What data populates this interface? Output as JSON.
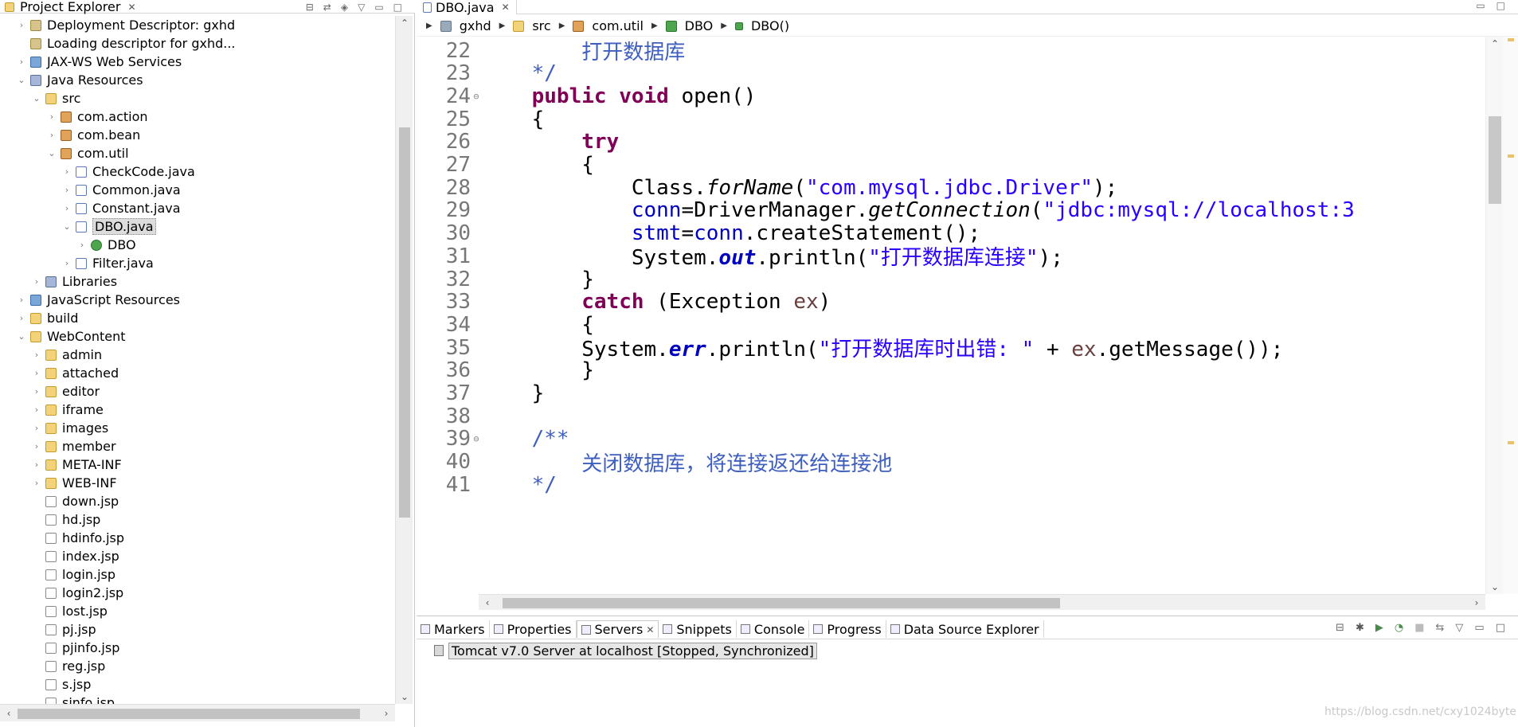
{
  "project_explorer": {
    "title": "Project Explorer",
    "tree": [
      {
        "label": "Deployment Descriptor: gxhd",
        "indent": 1,
        "twisty": ">",
        "icon": "descriptor-icon"
      },
      {
        "label": "Loading descriptor for gxhd...",
        "indent": 1,
        "twisty": "",
        "icon": "descriptor-icon"
      },
      {
        "label": "JAX-WS Web Services",
        "indent": 1,
        "twisty": ">",
        "icon": "web-services-icon"
      },
      {
        "label": "Java Resources",
        "indent": 1,
        "twisty": "v",
        "icon": "java-resources-icon"
      },
      {
        "label": "src",
        "indent": 2,
        "twisty": "v",
        "icon": "source-folder-icon"
      },
      {
        "label": "com.action",
        "indent": 3,
        "twisty": ">",
        "icon": "package-icon"
      },
      {
        "label": "com.bean",
        "indent": 3,
        "twisty": ">",
        "icon": "package-icon"
      },
      {
        "label": "com.util",
        "indent": 3,
        "twisty": "v",
        "icon": "package-icon"
      },
      {
        "label": "CheckCode.java",
        "indent": 4,
        "twisty": ">",
        "icon": "java-file-icon"
      },
      {
        "label": "Common.java",
        "indent": 4,
        "twisty": ">",
        "icon": "java-file-icon"
      },
      {
        "label": "Constant.java",
        "indent": 4,
        "twisty": ">",
        "icon": "java-file-icon"
      },
      {
        "label": "DBO.java",
        "indent": 4,
        "twisty": "v",
        "icon": "java-file-icon",
        "selected": true
      },
      {
        "label": "DBO",
        "indent": 5,
        "twisty": ">",
        "icon": "class-icon"
      },
      {
        "label": "Filter.java",
        "indent": 4,
        "twisty": ">",
        "icon": "java-file-icon"
      },
      {
        "label": "Libraries",
        "indent": 2,
        "twisty": ">",
        "icon": "libraries-icon"
      },
      {
        "label": "JavaScript Resources",
        "indent": 1,
        "twisty": ">",
        "icon": "js-resources-icon"
      },
      {
        "label": "build",
        "indent": 1,
        "twisty": ">",
        "icon": "folder-icon"
      },
      {
        "label": "WebContent",
        "indent": 1,
        "twisty": "v",
        "icon": "folder-icon"
      },
      {
        "label": "admin",
        "indent": 2,
        "twisty": ">",
        "icon": "folder-icon"
      },
      {
        "label": "attached",
        "indent": 2,
        "twisty": ">",
        "icon": "folder-icon"
      },
      {
        "label": "editor",
        "indent": 2,
        "twisty": ">",
        "icon": "folder-icon"
      },
      {
        "label": "iframe",
        "indent": 2,
        "twisty": ">",
        "icon": "folder-icon"
      },
      {
        "label": "images",
        "indent": 2,
        "twisty": ">",
        "icon": "folder-icon"
      },
      {
        "label": "member",
        "indent": 2,
        "twisty": ">",
        "icon": "folder-icon"
      },
      {
        "label": "META-INF",
        "indent": 2,
        "twisty": ">",
        "icon": "folder-icon"
      },
      {
        "label": "WEB-INF",
        "indent": 2,
        "twisty": ">",
        "icon": "folder-icon"
      },
      {
        "label": "down.jsp",
        "indent": 2,
        "twisty": "",
        "icon": "jsp-file-icon"
      },
      {
        "label": "hd.jsp",
        "indent": 2,
        "twisty": "",
        "icon": "jsp-file-icon"
      },
      {
        "label": "hdinfo.jsp",
        "indent": 2,
        "twisty": "",
        "icon": "jsp-file-icon"
      },
      {
        "label": "index.jsp",
        "indent": 2,
        "twisty": "",
        "icon": "jsp-file-icon"
      },
      {
        "label": "login.jsp",
        "indent": 2,
        "twisty": "",
        "icon": "jsp-file-icon"
      },
      {
        "label": "login2.jsp",
        "indent": 2,
        "twisty": "",
        "icon": "jsp-file-icon"
      },
      {
        "label": "lost.jsp",
        "indent": 2,
        "twisty": "",
        "icon": "jsp-file-icon"
      },
      {
        "label": "pj.jsp",
        "indent": 2,
        "twisty": "",
        "icon": "jsp-file-icon"
      },
      {
        "label": "pjinfo.jsp",
        "indent": 2,
        "twisty": "",
        "icon": "jsp-file-icon"
      },
      {
        "label": "reg.jsp",
        "indent": 2,
        "twisty": "",
        "icon": "jsp-file-icon"
      },
      {
        "label": "s.jsp",
        "indent": 2,
        "twisty": "",
        "icon": "jsp-file-icon"
      },
      {
        "label": "sinfo.jsp",
        "indent": 2,
        "twisty": "",
        "icon": "jsp-file-icon"
      }
    ]
  },
  "editor": {
    "tab_label": "DBO.java",
    "breadcrumb": [
      "gxhd",
      "src",
      "com.util",
      "DBO",
      "DBO()"
    ],
    "lines": [
      {
        "n": "22",
        "fold": "",
        "tokens": [
          {
            "t": "        打开数据库",
            "c": "cm"
          }
        ]
      },
      {
        "n": "23",
        "fold": "",
        "tokens": [
          {
            "t": "    */",
            "c": "cm"
          }
        ]
      },
      {
        "n": "24",
        "fold": "⊖",
        "tokens": [
          {
            "t": "    "
          },
          {
            "t": "public",
            "c": "kw"
          },
          {
            "t": " "
          },
          {
            "t": "void",
            "c": "kw"
          },
          {
            "t": " open()"
          }
        ]
      },
      {
        "n": "25",
        "fold": "",
        "tokens": [
          {
            "t": "    {"
          }
        ]
      },
      {
        "n": "26",
        "fold": "",
        "tokens": [
          {
            "t": "        "
          },
          {
            "t": "try",
            "c": "kw"
          }
        ]
      },
      {
        "n": "27",
        "fold": "",
        "tokens": [
          {
            "t": "        {"
          }
        ]
      },
      {
        "n": "28",
        "fold": "",
        "tokens": [
          {
            "t": "            Class."
          },
          {
            "t": "forName",
            "c": "smeth"
          },
          {
            "t": "("
          },
          {
            "t": "\"com.mysql.jdbc.Driver\"",
            "c": "str"
          },
          {
            "t": ");"
          }
        ]
      },
      {
        "n": "29",
        "fold": "",
        "tokens": [
          {
            "t": "            "
          },
          {
            "t": "conn",
            "c": "fld"
          },
          {
            "t": "=DriverManager."
          },
          {
            "t": "getConnection",
            "c": "smeth"
          },
          {
            "t": "("
          },
          {
            "t": "\"jdbc:mysql://localhost:3",
            "c": "str"
          }
        ]
      },
      {
        "n": "30",
        "fold": "",
        "tokens": [
          {
            "t": "            "
          },
          {
            "t": "stmt",
            "c": "fld"
          },
          {
            "t": "="
          },
          {
            "t": "conn",
            "c": "fld"
          },
          {
            "t": ".createStatement();"
          }
        ]
      },
      {
        "n": "31",
        "fold": "",
        "tokens": [
          {
            "t": "            System."
          },
          {
            "t": "out",
            "c": "sfld"
          },
          {
            "t": ".println("
          },
          {
            "t": "\"打开数据库连接\"",
            "c": "str"
          },
          {
            "t": ");"
          }
        ]
      },
      {
        "n": "32",
        "fold": "",
        "tokens": [
          {
            "t": "        }"
          }
        ]
      },
      {
        "n": "33",
        "fold": "",
        "tokens": [
          {
            "t": "        "
          },
          {
            "t": "catch",
            "c": "kw"
          },
          {
            "t": " (Exception "
          },
          {
            "t": "ex",
            "c": "loc"
          },
          {
            "t": ")"
          }
        ]
      },
      {
        "n": "34",
        "fold": "",
        "tokens": [
          {
            "t": "        {"
          }
        ]
      },
      {
        "n": "35",
        "fold": "",
        "tokens": [
          {
            "t": "        System."
          },
          {
            "t": "err",
            "c": "sfld"
          },
          {
            "t": ".println("
          },
          {
            "t": "\"打开数据库时出错: \"",
            "c": "str"
          },
          {
            "t": " + "
          },
          {
            "t": "ex",
            "c": "loc"
          },
          {
            "t": ".getMessage());"
          }
        ]
      },
      {
        "n": "36",
        "fold": "",
        "tokens": [
          {
            "t": "        }"
          }
        ]
      },
      {
        "n": "37",
        "fold": "",
        "tokens": [
          {
            "t": "    }"
          }
        ]
      },
      {
        "n": "38",
        "fold": "",
        "tokens": [
          {
            "t": ""
          }
        ]
      },
      {
        "n": "39",
        "fold": "⊖",
        "tokens": [
          {
            "t": "    /**",
            "c": "cm"
          }
        ]
      },
      {
        "n": "40",
        "fold": "",
        "tokens": [
          {
            "t": "        关闭数据库，将连接返还给连接池",
            "c": "cm"
          }
        ]
      },
      {
        "n": "41",
        "fold": "",
        "tokens": [
          {
            "t": "    */",
            "c": "cm"
          }
        ]
      }
    ]
  },
  "bottom_panel": {
    "tabs": [
      {
        "label": "Markers",
        "name": "tab-markers",
        "icon": "markers-icon"
      },
      {
        "label": "Properties",
        "name": "tab-properties",
        "icon": "properties-icon"
      },
      {
        "label": "Servers",
        "name": "tab-servers",
        "icon": "servers-icon",
        "active": true
      },
      {
        "label": "Snippets",
        "name": "tab-snippets",
        "icon": "snippets-icon"
      },
      {
        "label": "Console",
        "name": "tab-console",
        "icon": "console-icon"
      },
      {
        "label": "Progress",
        "name": "tab-progress",
        "icon": "progress-icon"
      },
      {
        "label": "Data Source Explorer",
        "name": "tab-data-source-explorer",
        "icon": "data-source-icon"
      }
    ],
    "server_entry": "Tomcat v7.0 Server at localhost  [Stopped, Synchronized]"
  },
  "watermark": "https://blog.csdn.net/cxy1024byte"
}
